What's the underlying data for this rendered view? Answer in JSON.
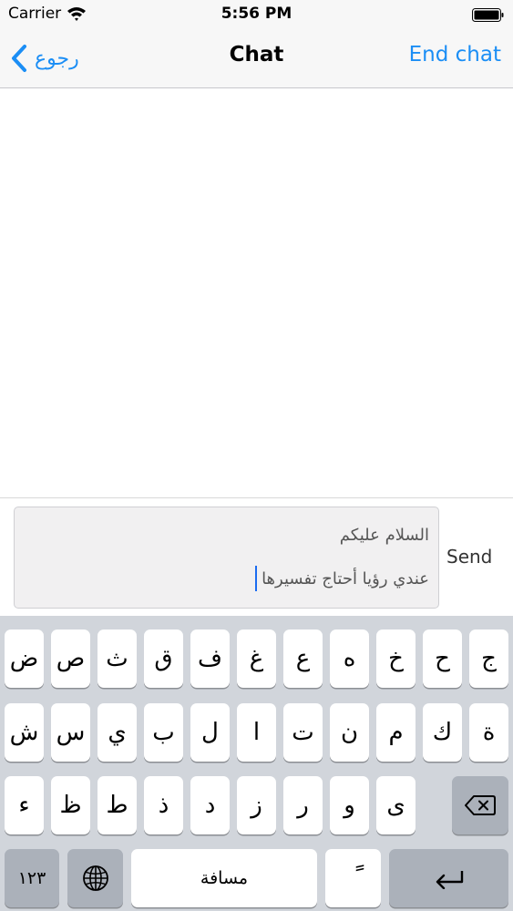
{
  "status_bar": {
    "carrier": "Carrier",
    "time": "5:56 PM"
  },
  "nav": {
    "back_label": "رجوع",
    "title": "Chat",
    "end_chat_label": "End chat"
  },
  "input": {
    "message_lines": [
      "السلام عليكم",
      "عندي رؤيا أحتاج تفسيرها"
    ],
    "send_label": "Send"
  },
  "keyboard": {
    "row1": [
      "ض",
      "ص",
      "ث",
      "ق",
      "ف",
      "غ",
      "ع",
      "ه",
      "خ",
      "ح",
      "ج"
    ],
    "row2": [
      "ش",
      "س",
      "ي",
      "ب",
      "ل",
      "ا",
      "ت",
      "ن",
      "م",
      "ك",
      "ة"
    ],
    "row3": [
      "ء",
      "ظ",
      "ط",
      "ذ",
      "د",
      "ز",
      "ر",
      "و",
      "ى"
    ],
    "numbers_label": "١٢٣",
    "space_label": "مسافة",
    "tanween_label": "ً",
    "icons": {
      "globe": "globe-icon",
      "delete": "backspace-icon",
      "return": "return-icon"
    }
  },
  "colors": {
    "accent": "#1b8ef5",
    "keyboard_bg": "#d1d5db",
    "dark_key": "#abb1ba"
  }
}
